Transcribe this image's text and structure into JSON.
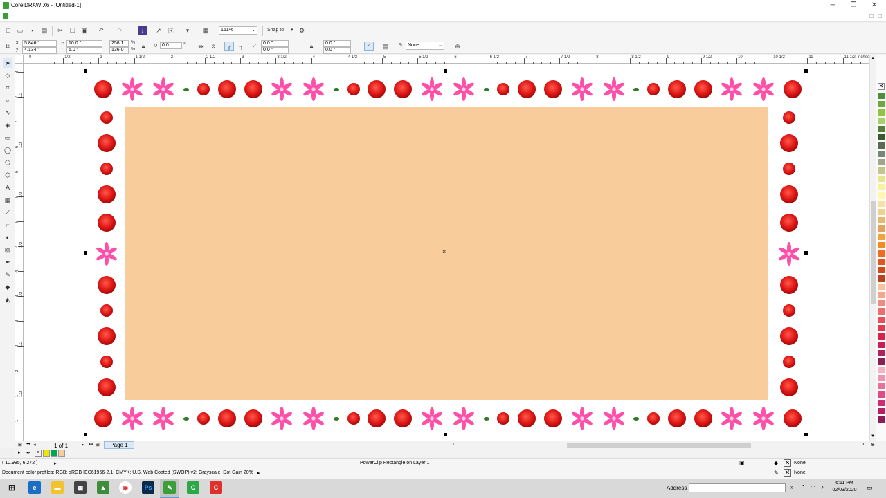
{
  "window": {
    "title": "CorelDRAW X6 - [Untitled-1]",
    "minimize": "─",
    "maximize": "❐",
    "close": "✕"
  },
  "toolbar": {
    "zoom": "161%",
    "snap_to": "Snap to"
  },
  "propbar": {
    "x": "5.846 \"",
    "y": "4.134 \"",
    "w": "10.0 \"",
    "h": "5.0 \"",
    "scale_w": "258.1",
    "scale_h": "136.0",
    "pct": "%",
    "angle": "0.0",
    "deg": "°",
    "corner_tl": "0.0 \"",
    "corner_bl": "0.0 \"",
    "corner_tr": "0.0 \"",
    "corner_br": "0.0 \"",
    "outline": "None"
  },
  "ruler": {
    "unit": "inches",
    "h_labels": [
      "0",
      "1/2",
      "1",
      "1 1/2",
      "2",
      "2 1/2",
      "3",
      "3 1/2",
      "4",
      "4 1/2",
      "5",
      "5 1/2",
      "6",
      "6 1/2",
      "7",
      "7 1/2",
      "8",
      "8 1/2",
      "9",
      "9 1/2",
      "10",
      "10 1/2",
      "11",
      "11 1/2"
    ],
    "v_labels": [
      "8",
      "7 1/2",
      "7",
      "6 1/2",
      "6",
      "5 1/2",
      "5",
      "4 1/2",
      "4",
      "3 1/2",
      "3",
      "2 1/2",
      "2",
      "1 1/2",
      "1"
    ]
  },
  "pages": {
    "count": "1 of 1",
    "tab": "Page 1"
  },
  "status": {
    "coords": "( 10.985, 6.272 )",
    "object": "PowerClip Rectangle on Layer 1",
    "fill": "None",
    "outline": "None",
    "profiles": "Document color profiles: RGB: sRGB IEC61966-2.1; CMYK: U.S. Web Coated (SWOP) v2; Grayscale: Dot Gain 20%"
  },
  "taskbar": {
    "address_label": "Address",
    "time": "6:11 PM",
    "date": "02/03/2020"
  },
  "colors": {
    "fill": "#f8cd9b",
    "accent_green": "#3a9e3a",
    "rose": "#e01818",
    "lily": "#ff4fa8"
  },
  "palette": [
    "#4c8f3b",
    "#6ea83f",
    "#8ec63f",
    "#a6d26a",
    "#55803a",
    "#3b5a2e",
    "#5a6b52",
    "#76887a",
    "#a4a48a",
    "#c6c68a",
    "#e6e690",
    "#f6f39a",
    "#fff7b0",
    "#f6e3a4",
    "#efd38c",
    "#e6b870",
    "#e2a45a",
    "#f4a13a",
    "#f58a1f",
    "#f36b21",
    "#e6551e",
    "#d24a1a",
    "#b9441c",
    "#f9c39a",
    "#f6a58a",
    "#f18a80",
    "#ec6f6c",
    "#e6505c",
    "#e23a4c",
    "#d8224a",
    "#c81e55",
    "#b0215f",
    "#8a1f55",
    "#f4b4c4",
    "#f092b0",
    "#e8709a",
    "#e04a86",
    "#d02a72",
    "#b81e66",
    "#8e1c56"
  ],
  "doc_palette": [
    "#f2e600",
    "#00a651",
    "#f8cd9b"
  ]
}
